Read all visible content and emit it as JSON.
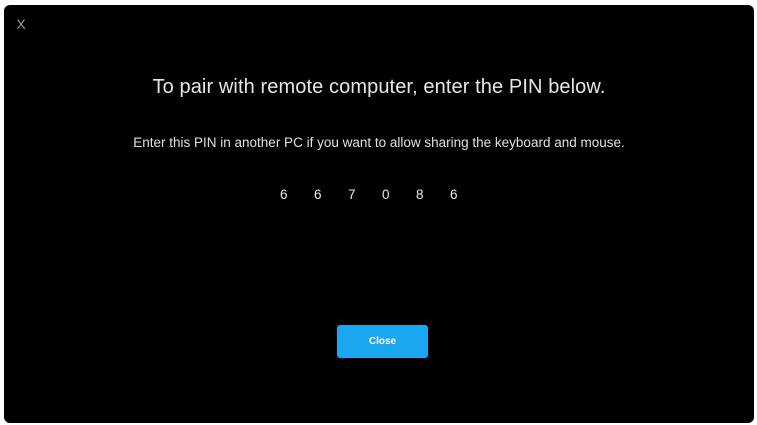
{
  "dialog": {
    "close_icon_label": "X",
    "title": "To pair with remote computer, enter the PIN below.",
    "subtitle": "Enter this PIN in another PC if you want to allow sharing the keyboard and mouse.",
    "pin_digits": [
      "6",
      "6",
      "7",
      "0",
      "8",
      "6"
    ],
    "close_button_label": "Close"
  },
  "colors": {
    "background": "#000000",
    "accent": "#1aa7f0",
    "text": "#e6e6e6"
  }
}
